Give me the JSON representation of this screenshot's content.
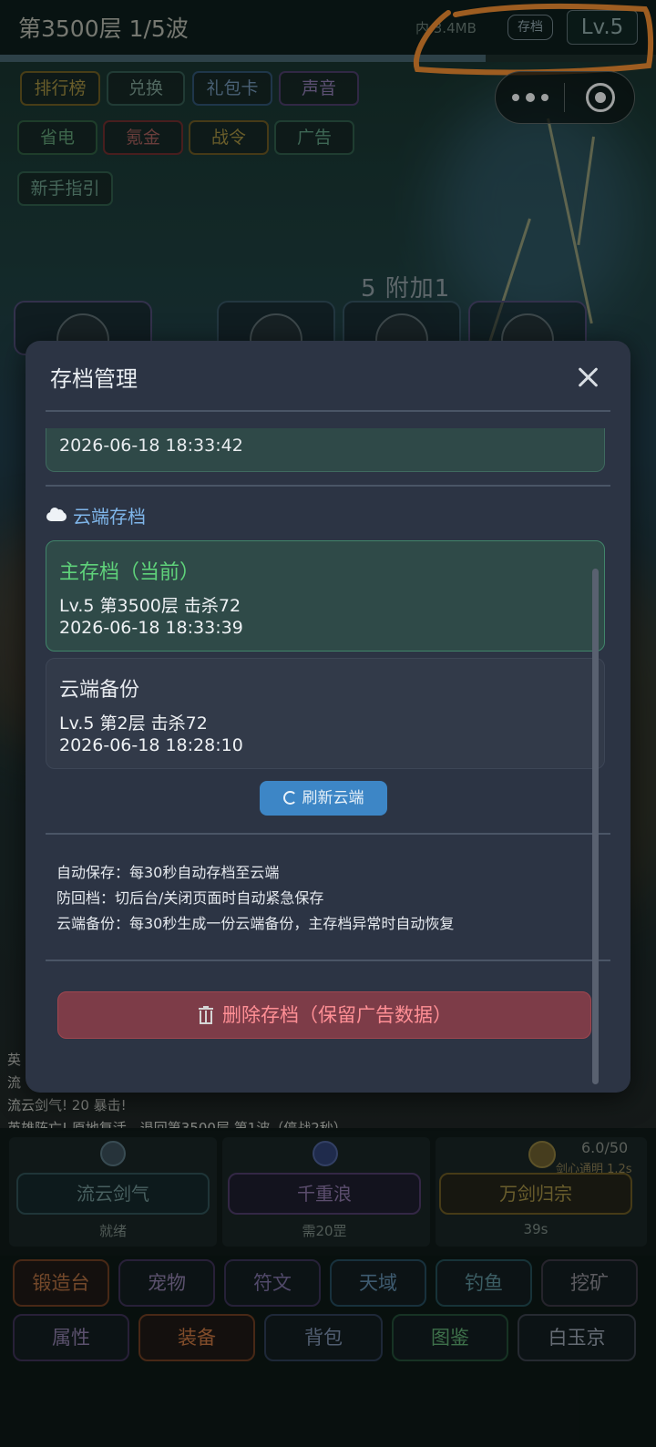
{
  "header": {
    "title": "第3500层  1/5波",
    "memory": "内  3.4MB",
    "save_badge": "存档",
    "level": "Lv.5",
    "progress": 0.74
  },
  "menu": [
    {
      "label": "排行榜"
    },
    {
      "label": "兑换"
    },
    {
      "label": "礼包卡"
    },
    {
      "label": "声音"
    },
    {
      "label": "省电"
    },
    {
      "label": "氪金"
    },
    {
      "label": "战令"
    },
    {
      "label": "广告"
    },
    {
      "label": "新手指引"
    }
  ],
  "battle": {
    "wave_bonus": "5 附加1"
  },
  "modal": {
    "title": "存档管理",
    "local_time": "2026-06-18 18:33:42",
    "cloud_heading": "云端存档",
    "slots": [
      {
        "title": "主存档（当前）",
        "line1": "Lv.5 第3500层 击杀72",
        "line2": "2026-06-18 18:33:39"
      },
      {
        "title": "云端备份",
        "line1": "Lv.5 第2层 击杀72",
        "line2": "2026-06-18 18:28:10"
      }
    ],
    "refresh_label": "刷新云端",
    "info": [
      "自动保存：每30秒自动存档至云端",
      "防回档：切后台/关闭页面时自动紧急保存",
      "云端备份：每30秒生成一份云端备份，主存档异常时自动恢复"
    ],
    "delete_label": "删除存档（保留广告数据）"
  },
  "log": [
    "英",
    "流",
    "流云剑气! 20 暴击!",
    "英雄阵亡! 原地复活，退回第3500层 第1波（停战2秒）"
  ],
  "skills": {
    "energy": "6.0/50",
    "energy_note": "剑心通明 1.2s",
    "items": [
      {
        "label": "流云剑气",
        "caption": "就绪"
      },
      {
        "label": "千重浪",
        "caption": "需20罡"
      },
      {
        "label": "万剑归宗",
        "caption": "39s"
      }
    ]
  },
  "nav": {
    "row1": [
      "锻造台",
      "宠物",
      "符文",
      "天域",
      "钓鱼",
      "挖矿"
    ],
    "row2": [
      "属性",
      "装备",
      "背包",
      "图鉴",
      "白玉京"
    ]
  }
}
